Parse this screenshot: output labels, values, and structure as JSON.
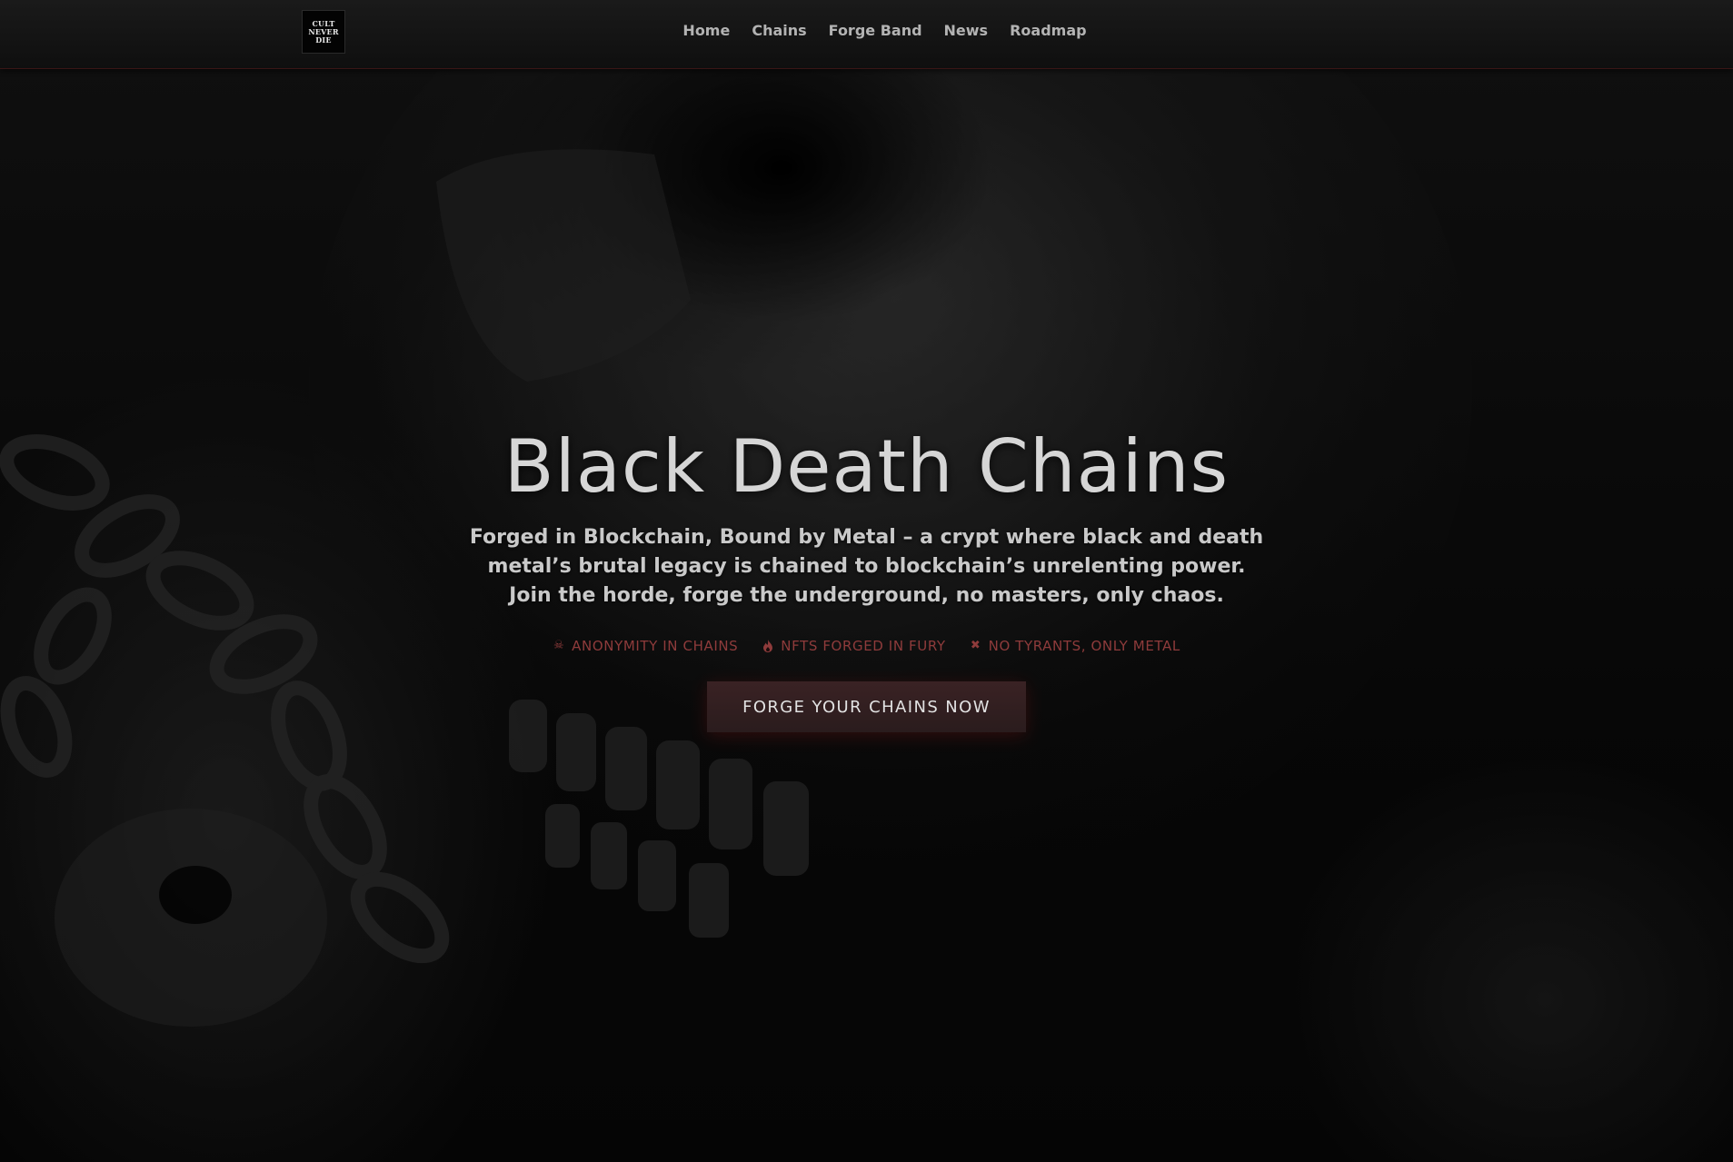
{
  "header": {
    "logo_lines": [
      "CULT",
      "NEVER",
      "DIE"
    ],
    "nav": [
      {
        "label": "Home"
      },
      {
        "label": "Chains"
      },
      {
        "label": "Forge Band"
      },
      {
        "label": "News"
      },
      {
        "label": "Roadmap"
      }
    ]
  },
  "hero": {
    "title": "Black Death Chains",
    "subtitle": "Forged in Blockchain, Bound by Metal – a crypt where black and death metal’s brutal legacy is chained to blockchain’s unrelenting power. Join the horde, forge the underground, no masters, only chaos.",
    "features": [
      {
        "icon": "skull-crossbones-icon",
        "glyph": "☠",
        "label": "ANONYMITY IN CHAINS"
      },
      {
        "icon": "flame-icon",
        "glyph": "🔥",
        "label": "NFTS FORGED IN FURY"
      },
      {
        "icon": "cross-icon",
        "glyph": "✖",
        "label": "NO TYRANTS, ONLY METAL"
      }
    ],
    "cta_label": "FORGE YOUR CHAINS NOW"
  },
  "colors": {
    "accent": "#8e3b3b",
    "cta_bg": "#33201f",
    "text": "#d6d6d6",
    "background": "#0a0a0a"
  }
}
